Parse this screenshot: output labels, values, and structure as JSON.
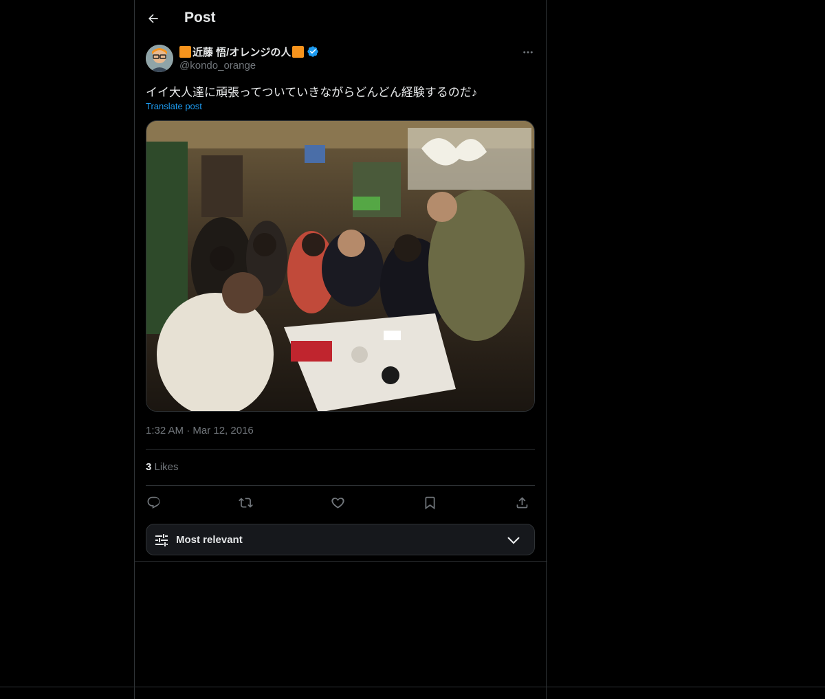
{
  "header": {
    "title": "Post"
  },
  "author": {
    "display_name": "近藤 悟/オレンジの人",
    "handle": "@kondo_orange",
    "verified": true,
    "name_emoji_color": "#f7941d"
  },
  "tweet": {
    "text": "イイ大人達に頑張ってついていきながらどんどん経験するのだ♪",
    "translate_label": "Translate post",
    "timestamp": "1:32 AM · Mar 12, 2016",
    "likes_count": "3",
    "likes_label": " Likes"
  },
  "actions": {
    "icons": [
      "reply-icon",
      "retweet-icon",
      "like-icon",
      "bookmark-icon",
      "share-icon"
    ]
  },
  "sort": {
    "label": "Most relevant"
  },
  "colors": {
    "accent": "#1d9bf0",
    "background": "#000000",
    "muted": "#71767b",
    "border": "#2f3336"
  }
}
